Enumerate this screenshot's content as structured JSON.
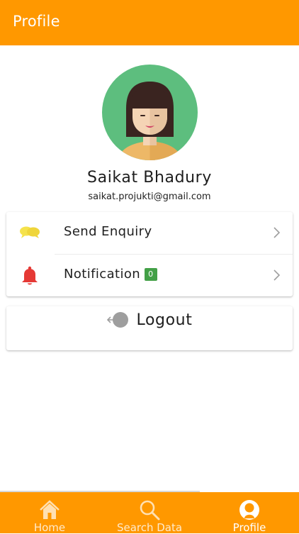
{
  "app_bar": {
    "title": "Profile"
  },
  "profile": {
    "name": "Saikat Bhadury",
    "email": "saikat.projukti@gmail.com"
  },
  "menu": {
    "items": [
      {
        "label": "Send Enquiry",
        "icon": "chat-bubbles-icon"
      },
      {
        "label": "Notification",
        "icon": "bell-icon",
        "badge": "0"
      }
    ]
  },
  "logout": {
    "label": "Logout",
    "icon": "logout-arrow-icon"
  },
  "bottom_nav": {
    "items": [
      {
        "label": "Home",
        "icon": "home-icon"
      },
      {
        "label": "Search Data",
        "icon": "search-icon"
      },
      {
        "label": "Profile",
        "icon": "profile-icon",
        "active": true
      }
    ]
  },
  "colors": {
    "primary": "#FF9800",
    "avatar_bg": "#5DBE7E",
    "badge": "#43A047",
    "bell": "#E53935",
    "chat": "#F5E24B"
  }
}
